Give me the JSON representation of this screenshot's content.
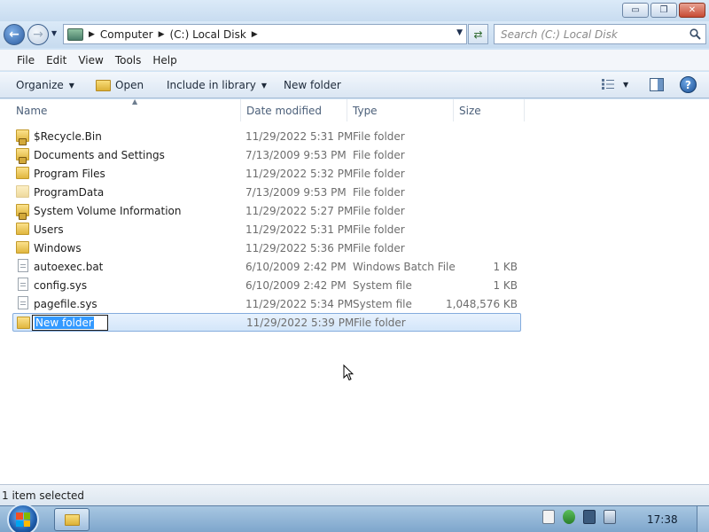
{
  "window": {
    "controls": {
      "minimize": "▭",
      "maximize": "❐",
      "close": "✕"
    }
  },
  "address": {
    "breadcrumbs": [
      "Computer",
      "(C:) Local Disk"
    ],
    "search_placeholder": "Search (C:) Local Disk"
  },
  "menubar": {
    "items": [
      {
        "label": "File"
      },
      {
        "label": "Edit"
      },
      {
        "label": "View"
      },
      {
        "label": "Tools"
      },
      {
        "label": "Help"
      }
    ]
  },
  "commandbar": {
    "organize": "Organize",
    "open": "Open",
    "include_in_library": "Include in library",
    "new_folder": "New folder"
  },
  "columns": {
    "name": "Name",
    "date_modified": "Date modified",
    "type": "Type",
    "size": "Size"
  },
  "files": [
    {
      "name": "$Recycle.Bin",
      "date": "11/29/2022 5:31 PM",
      "type": "File folder",
      "size": "",
      "icon": "locked-folder-icon"
    },
    {
      "name": "Documents and Settings",
      "date": "7/13/2009 9:53 PM",
      "type": "File folder",
      "size": "",
      "icon": "locked-folder-icon"
    },
    {
      "name": "Program Files",
      "date": "11/29/2022 5:32 PM",
      "type": "File folder",
      "size": "",
      "icon": "folder-icon"
    },
    {
      "name": "ProgramData",
      "date": "7/13/2009 9:53 PM",
      "type": "File folder",
      "size": "",
      "icon": "hidden-folder-icon"
    },
    {
      "name": "System Volume Information",
      "date": "11/29/2022 5:27 PM",
      "type": "File folder",
      "size": "",
      "icon": "locked-folder-icon"
    },
    {
      "name": "Users",
      "date": "11/29/2022 5:31 PM",
      "type": "File folder",
      "size": "",
      "icon": "folder-icon"
    },
    {
      "name": "Windows",
      "date": "11/29/2022 5:36 PM",
      "type": "File folder",
      "size": "",
      "icon": "folder-icon"
    },
    {
      "name": "autoexec.bat",
      "date": "6/10/2009 2:42 PM",
      "type": "Windows Batch File",
      "size": "1 KB",
      "icon": "batch-file-icon"
    },
    {
      "name": "config.sys",
      "date": "6/10/2009 2:42 PM",
      "type": "System file",
      "size": "1 KB",
      "icon": "system-file-icon"
    },
    {
      "name": "pagefile.sys",
      "date": "11/29/2022 5:34 PM",
      "type": "System file",
      "size": "1,048,576 KB",
      "icon": "system-file-icon"
    }
  ],
  "new_folder_row": {
    "name": "New folder",
    "date": "11/29/2022 5:39 PM",
    "type": "File folder",
    "size": ""
  },
  "status": {
    "text": "1 item selected"
  },
  "taskbar": {
    "clock": "17:38"
  },
  "colors": {
    "selection_fill": "#d3e6fa",
    "selection_border": "#84acdd",
    "text_highlight": "#3399ff"
  }
}
